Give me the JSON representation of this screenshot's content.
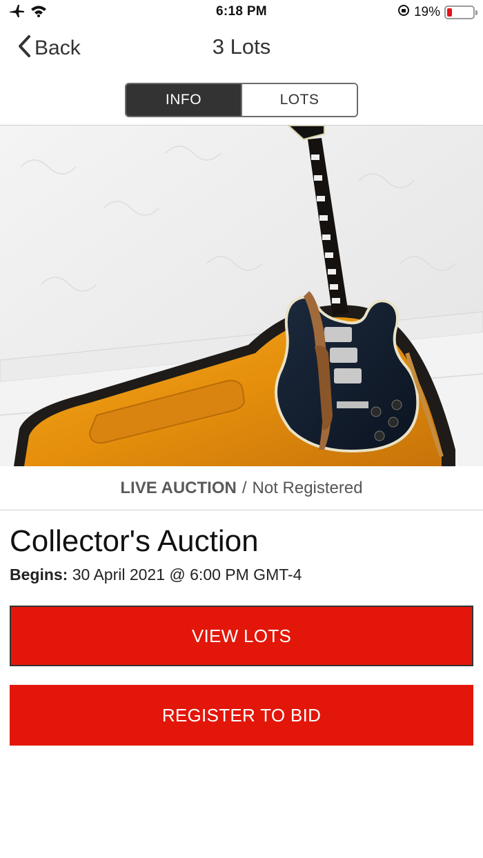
{
  "status_bar": {
    "time": "6:18 PM",
    "battery_percent": "19%",
    "battery_level": 0.19,
    "icons": [
      "airplane-icon",
      "wifi-icon",
      "rotation-lock-icon",
      "battery-icon"
    ]
  },
  "nav": {
    "back_label": "Back",
    "title": "3 Lots"
  },
  "tabs": [
    {
      "label": "INFO",
      "active": true
    },
    {
      "label": "LOTS",
      "active": false
    }
  ],
  "hero": {
    "subject": "guitar-case-photo"
  },
  "auction": {
    "type": "LIVE AUCTION",
    "separator": "/",
    "registration_status": "Not Registered",
    "title": "Collector's Auction",
    "begins_label": "Begins:",
    "begins_value": "30 April 2021 @ 6:00 PM GMT-4"
  },
  "buttons": {
    "view_lots": "VIEW LOTS",
    "register": "REGISTER TO BID"
  },
  "colors": {
    "accent": "#e3160a",
    "segment_active": "#333333"
  }
}
